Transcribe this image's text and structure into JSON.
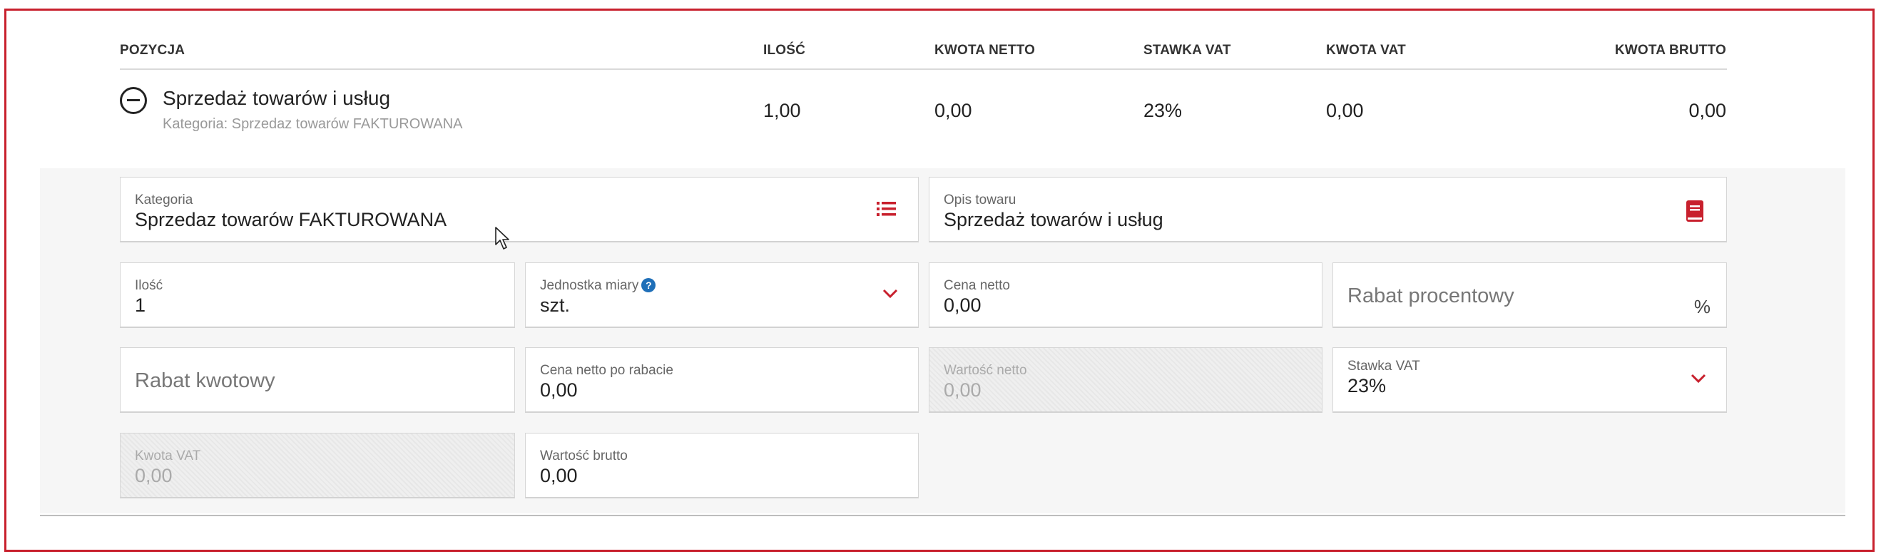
{
  "columns": {
    "position": "POZYCJA",
    "quantity": "ILOŚĆ",
    "net_amount": "KWOTA NETTO",
    "vat_rate": "STAWKA VAT",
    "vat_amount": "KWOTA VAT",
    "gross_amount": "KWOTA BRUTTO"
  },
  "item": {
    "title": "Sprzedaż towarów i usług",
    "subtitle": "Kategoria: Sprzedaz towarów FAKTUROWANA",
    "quantity": "1,00",
    "net_amount": "0,00",
    "vat_rate": "23%",
    "vat_amount": "0,00",
    "gross_amount": "0,00"
  },
  "form": {
    "category": {
      "label": "Kategoria",
      "value": "Sprzedaz towarów FAKTUROWANA"
    },
    "description": {
      "label": "Opis towaru",
      "value": "Sprzedaż towarów i usług"
    },
    "quantity": {
      "label": "Ilość",
      "value": "1"
    },
    "unit": {
      "label": "Jednostka miary",
      "value": "szt.",
      "help": "?"
    },
    "net_price": {
      "label": "Cena netto",
      "value": "0,00"
    },
    "percent_discount": {
      "placeholder": "Rabat procentowy",
      "suffix": "%"
    },
    "amount_discount": {
      "placeholder": "Rabat kwotowy"
    },
    "net_after_discount": {
      "label": "Cena netto po rabacie",
      "value": "0,00"
    },
    "net_value": {
      "label": "Wartość netto",
      "value": "0,00"
    },
    "vat_rate": {
      "label": "Stawka VAT",
      "value": "23%"
    },
    "vat_amount": {
      "label": "Kwota VAT",
      "value": "0,00"
    },
    "gross_value": {
      "label": "Wartość brutto",
      "value": "0,00"
    }
  },
  "icons": {
    "collapse": "minus-circle-icon",
    "category_list": "list-icon",
    "description_book": "book-icon",
    "dropdown": "chevron-down-icon",
    "help": "help-circle-icon"
  },
  "colors": {
    "accent": "#c8202d",
    "help": "#1f6fb8",
    "frame": "#c8202d"
  }
}
